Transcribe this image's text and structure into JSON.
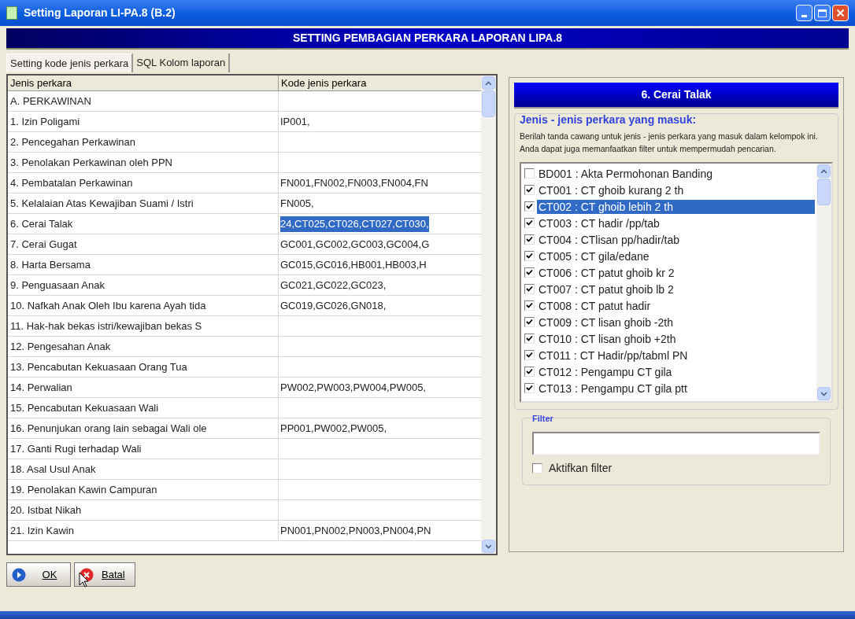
{
  "window": {
    "title": "Setting Laporan LI-PA.8 (B.2)"
  },
  "header": "SETTING PEMBAGIAN PERKARA LAPORAN LIPA.8",
  "tabs": [
    {
      "label": "Setting kode jenis perkara",
      "selected": true
    },
    {
      "label": "SQL Kolom laporan",
      "selected": false
    }
  ],
  "table": {
    "columns": [
      "Jenis perkara",
      "Kode jenis perkara"
    ],
    "rows": [
      {
        "jenis": "A. PERKAWINAN",
        "kode": "",
        "selected": false
      },
      {
        "jenis": "1. Izin Poligami",
        "kode": "IP001,",
        "selected": false
      },
      {
        "jenis": "2. Pencegahan Perkawinan",
        "kode": "",
        "selected": false
      },
      {
        "jenis": "3. Penolakan Perkawinan oleh PPN",
        "kode": "",
        "selected": false
      },
      {
        "jenis": "4. Pembatalan Perkawinan",
        "kode": "FN001,FN002,FN003,FN004,FN",
        "selected": false
      },
      {
        "jenis": "5. Kelalaian Atas Kewajiban Suami / Istri",
        "kode": "FN005,",
        "selected": false
      },
      {
        "jenis": "6. Cerai Talak",
        "kode": "24,CT025,CT026,CT027,CT030,",
        "selected": true
      },
      {
        "jenis": "7. Cerai Gugat",
        "kode": "GC001,GC002,GC003,GC004,G",
        "selected": false
      },
      {
        "jenis": "8. Harta Bersama",
        "kode": "GC015,GC016,HB001,HB003,H",
        "selected": false
      },
      {
        "jenis": "9. Penguasaan Anak",
        "kode": "GC021,GC022,GC023,",
        "selected": false
      },
      {
        "jenis": "10. Nafkah Anak Oleh Ibu karena Ayah tida",
        "kode": "GC019,GC026,GN018,",
        "selected": false
      },
      {
        "jenis": "11. Hak-hak bekas istri/kewajiban bekas S",
        "kode": "",
        "selected": false
      },
      {
        "jenis": "12. Pengesahan Anak",
        "kode": "",
        "selected": false
      },
      {
        "jenis": "13. Pencabutan Kekuasaan Orang Tua",
        "kode": "",
        "selected": false
      },
      {
        "jenis": "14. Perwalian",
        "kode": "PW002,PW003,PW004,PW005,",
        "selected": false
      },
      {
        "jenis": "15. Pencabutan Kekuasaan Wali",
        "kode": "",
        "selected": false
      },
      {
        "jenis": "16. Penunjukan orang lain sebagai Wali ole",
        "kode": "PP001,PW002,PW005,",
        "selected": false
      },
      {
        "jenis": "17. Ganti Rugi terhadap Wali",
        "kode": "",
        "selected": false
      },
      {
        "jenis": "18. Asal Usul Anak",
        "kode": "",
        "selected": false
      },
      {
        "jenis": "19. Penolakan Kawin Campuran",
        "kode": "",
        "selected": false
      },
      {
        "jenis": "20. Istbat Nikah",
        "kode": "",
        "selected": false
      },
      {
        "jenis": "21. Izin Kawin",
        "kode": "PN001,PN002,PN003,PN004,PN",
        "selected": false
      }
    ]
  },
  "panel": {
    "title": "6. Cerai Talak",
    "group_title": "Jenis - jenis perkara yang masuk:",
    "description": "Berilah tanda cawang untuk jenis - jenis perkara yang masuk dalam kelompok ini. Anda dapat juga memanfaatkan filter untuk mempermudah pencarian.",
    "items": [
      {
        "label": "BD001 : Akta Permohonan Banding",
        "checked": false,
        "selected": false
      },
      {
        "label": "CT001 : CT ghoib kurang 2 th",
        "checked": true,
        "selected": false
      },
      {
        "label": "CT002 : CT ghoib lebih 2 th",
        "checked": true,
        "selected": true
      },
      {
        "label": "CT003 : CT hadir /pp/tab",
        "checked": true,
        "selected": false
      },
      {
        "label": "CT004 : CTlisan pp/hadir/tab",
        "checked": true,
        "selected": false
      },
      {
        "label": "CT005 : CT gila/edane",
        "checked": true,
        "selected": false
      },
      {
        "label": "CT006 : CT patut ghoib kr 2",
        "checked": true,
        "selected": false
      },
      {
        "label": "CT007 : CT patut ghoib lb 2",
        "checked": true,
        "selected": false
      },
      {
        "label": "CT008 : CT patut hadir",
        "checked": true,
        "selected": false
      },
      {
        "label": "CT009 : CT lisan ghoib -2th",
        "checked": true,
        "selected": false
      },
      {
        "label": "CT010 : CT lisan ghoib +2th",
        "checked": true,
        "selected": false
      },
      {
        "label": "CT011 : CT Hadir/pp/tabml PN",
        "checked": true,
        "selected": false
      },
      {
        "label": "CT012 : Pengampu CT gila",
        "checked": true,
        "selected": false
      },
      {
        "label": "CT013 : Pengampu CT gila ptt",
        "checked": true,
        "selected": false
      }
    ],
    "filter": {
      "title": "Filter",
      "checkbox": {
        "label": "Aktifkan filter",
        "checked": false
      }
    }
  },
  "buttons": [
    {
      "label": "OK",
      "kind": "ok"
    },
    {
      "label": "Batal",
      "kind": "cancel"
    }
  ]
}
